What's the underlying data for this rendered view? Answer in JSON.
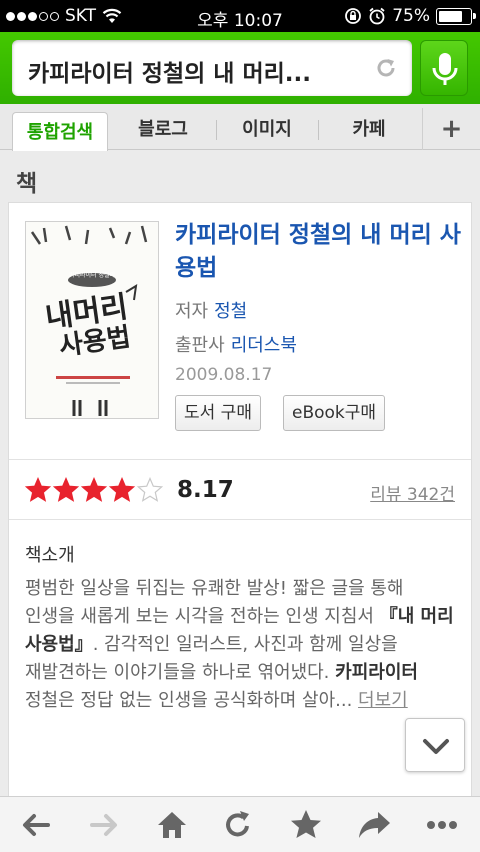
{
  "status_bar": {
    "carrier": "SKT",
    "time": "오후 10:07",
    "battery": "75%",
    "battery_level": 0.75
  },
  "search": {
    "query": "카피라이터 정철의 내 머리...",
    "icons": {
      "refresh": "refresh-icon",
      "mic": "microphone-icon"
    }
  },
  "tabs": [
    {
      "label": "통합검색",
      "active": true
    },
    {
      "label": "블로그",
      "active": false
    },
    {
      "label": "이미지",
      "active": false
    },
    {
      "label": "카페",
      "active": false
    }
  ],
  "tab_more": "+",
  "section": {
    "title": "책"
  },
  "book": {
    "title": "카피라이터 정철의 내 머리 사용법",
    "author_label": "저자",
    "author": "정철",
    "publisher_label": "출판사",
    "publisher": "리더스북",
    "date": "2009.08.17",
    "buy_button": "도서 구매",
    "ebook_button": "eBook구매",
    "cover": {
      "top_label": "카피라이터 정철의",
      "title_line1": "내머리",
      "title_line2": "사용법"
    }
  },
  "rating": {
    "score": "8.17",
    "stars_filled": 4,
    "stars_total": 5,
    "reviews": "리뷰 342건",
    "star_color": "#e8232e"
  },
  "intro": {
    "heading": "책소개",
    "part1": "평범한 일상을 뒤집는 유쾌한 발상! 짧은 글을 통해 인생을 새롭게 보는 시각을 전하는 인생 지침서 ",
    "bold1": "『내 머리 사용법』",
    "part2": ". 감각적인 일러스트, 사진과 함께 일상을 재발견하는 이야기들을 하나로 엮어냈다. ",
    "bold2": "카피라이터",
    "part3": " 정철은 정답 없는 인생을 공식화하며 살아... ",
    "more": "더보기"
  },
  "colors": {
    "accent_green": "#2fb000",
    "link_blue": "#1a56b0"
  }
}
